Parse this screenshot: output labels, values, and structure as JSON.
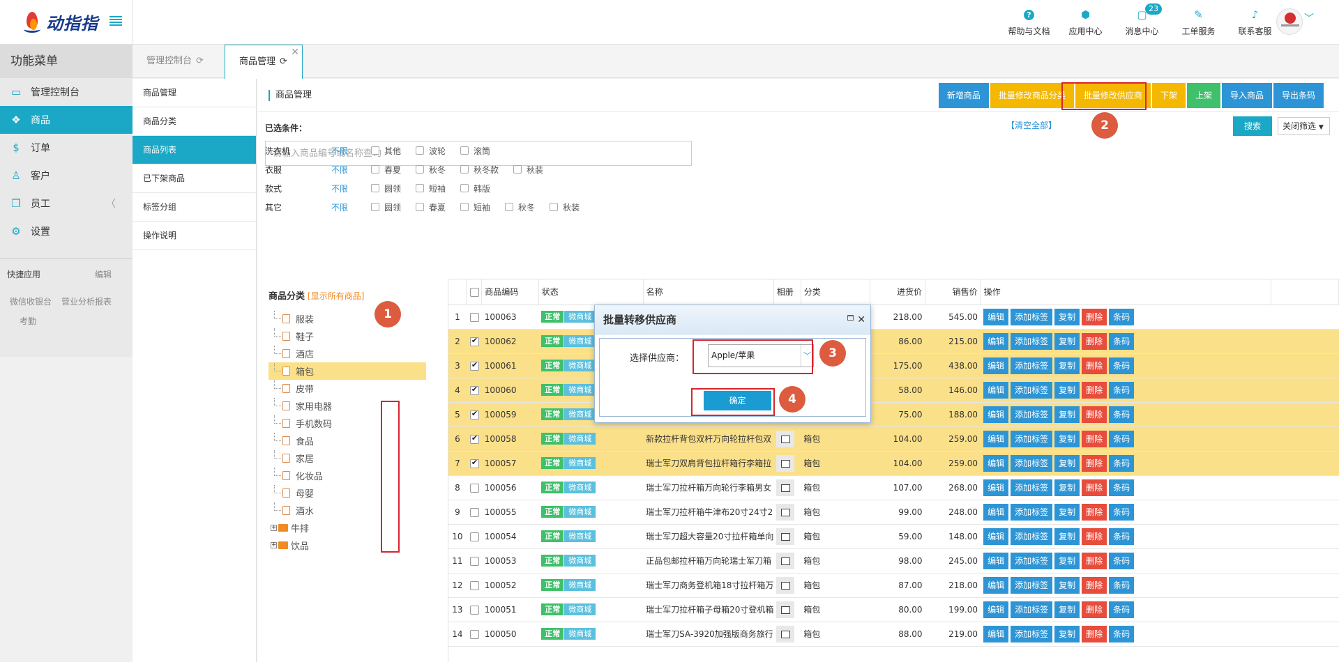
{
  "brand": {
    "logo_text": "动指指"
  },
  "sidebar": {
    "title": "功能菜单",
    "items": [
      {
        "label": "管理控制台",
        "icon": "monitor-icon"
      },
      {
        "label": "商品",
        "icon": "gift-icon",
        "active": true
      },
      {
        "label": "订单",
        "icon": "dollar-icon"
      },
      {
        "label": "客户",
        "icon": "user-icon"
      },
      {
        "label": "员工",
        "icon": "copy-icon"
      },
      {
        "label": "设置",
        "icon": "gear-icon"
      }
    ],
    "quick_apps_label": "快捷应用",
    "quick_edit_label": "编辑",
    "quick_links": [
      "微信收银台",
      "营业分析报表",
      "考勤"
    ]
  },
  "topnav": {
    "items": [
      {
        "label": "帮助与文档",
        "icon": "help-icon"
      },
      {
        "label": "应用中心",
        "icon": "cube-icon"
      },
      {
        "label": "消息中心",
        "icon": "message-icon",
        "badge": "23"
      },
      {
        "label": "工单服务",
        "icon": "pencil-icon"
      },
      {
        "label": "联系客服",
        "icon": "bell-icon"
      }
    ]
  },
  "tabs": [
    {
      "label": "管理控制台"
    },
    {
      "label": "商品管理",
      "active": true
    }
  ],
  "submenu": [
    "商品管理",
    "商品分类",
    "商品列表",
    "已下架商品",
    "标签分组",
    "操作说明"
  ],
  "main": {
    "page_title": "商品管理",
    "actions": [
      "新增商品",
      "批量修改商品分类",
      "批量修改供应商",
      "下架",
      "上架",
      "导入商品",
      "导出条码"
    ],
    "selected_conditions_label": "已选条件：",
    "clear_all": "【清空全部】",
    "search_button": "搜索",
    "close_filter": "关闭筛选",
    "search_placeholder": "请输入商品编号或名称查询"
  },
  "filters": [
    {
      "label": "洗衣机",
      "all": "不限",
      "options": [
        "其他",
        "波轮",
        "滚筒"
      ]
    },
    {
      "label": "衣服",
      "all": "不限",
      "options": [
        "春夏",
        "秋冬",
        "秋冬款",
        "秋装"
      ]
    },
    {
      "label": "款式",
      "all": "不限",
      "options": [
        "圆领",
        "短袖",
        "韩版"
      ]
    },
    {
      "label": "其它",
      "all": "不限",
      "options": [
        "圆领",
        "春夏",
        "短袖",
        "秋冬",
        "秋装"
      ]
    }
  ],
  "categories": {
    "title": "商品分类",
    "show_all": "[显示所有商品]",
    "items": [
      "服装",
      "鞋子",
      "酒店",
      "箱包",
      "皮带",
      "家用电器",
      "手机数码",
      "食品",
      "家居",
      "化妆品",
      "母婴",
      "酒水"
    ],
    "folders": [
      "牛排",
      "饮品"
    ],
    "selected": "箱包"
  },
  "table": {
    "columns": [
      "商品编码",
      "状态",
      "名称",
      "相册",
      "分类",
      "进货价",
      "销售价",
      "操作"
    ],
    "status_ok": "正常",
    "status_wx": "微商城",
    "ops": [
      "编辑",
      "添加标签",
      "复制",
      "删除",
      "条码"
    ],
    "rows": [
      {
        "idx": "1",
        "code": "100063",
        "name": "",
        "cat": "",
        "buy": "218.00",
        "sell": "545.00",
        "checked": false,
        "hl": false
      },
      {
        "idx": "2",
        "code": "100062",
        "name": "",
        "cat": "",
        "buy": "86.00",
        "sell": "215.00",
        "checked": true,
        "hl": true
      },
      {
        "idx": "3",
        "code": "100061",
        "name": "",
        "cat": "",
        "buy": "175.00",
        "sell": "438.00",
        "checked": true,
        "hl": true
      },
      {
        "idx": "4",
        "code": "100060",
        "name": "",
        "cat": "",
        "buy": "58.00",
        "sell": "146.00",
        "checked": true,
        "hl": true
      },
      {
        "idx": "5",
        "code": "100059",
        "name": "",
        "cat": "",
        "buy": "75.00",
        "sell": "188.00",
        "checked": true,
        "hl": true
      },
      {
        "idx": "6",
        "code": "100058",
        "name": "新款拉杆背包双杆万向轮拉杆包双",
        "cat": "箱包",
        "buy": "104.00",
        "sell": "259.00",
        "checked": true,
        "hl": true
      },
      {
        "idx": "7",
        "code": "100057",
        "name": "瑞士军刀双肩背包拉杆箱行李箱拉",
        "cat": "箱包",
        "buy": "104.00",
        "sell": "259.00",
        "checked": true,
        "hl": true
      },
      {
        "idx": "8",
        "code": "100056",
        "name": "瑞士军刀拉杆箱万向轮行李箱男女",
        "cat": "箱包",
        "buy": "107.00",
        "sell": "268.00",
        "checked": false,
        "hl": false
      },
      {
        "idx": "9",
        "code": "100055",
        "name": "瑞士军刀拉杆箱牛津布20寸24寸2",
        "cat": "箱包",
        "buy": "99.00",
        "sell": "248.00",
        "checked": false,
        "hl": false
      },
      {
        "idx": "10",
        "code": "100054",
        "name": "瑞士军刀超大容量20寸拉杆箱单向",
        "cat": "箱包",
        "buy": "59.00",
        "sell": "148.00",
        "checked": false,
        "hl": false
      },
      {
        "idx": "11",
        "code": "100053",
        "name": "正品包邮拉杆箱万向轮瑞士军刀箱",
        "cat": "箱包",
        "buy": "98.00",
        "sell": "245.00",
        "checked": false,
        "hl": false
      },
      {
        "idx": "12",
        "code": "100052",
        "name": "瑞士军刀商务登机箱18寸拉杆箱万",
        "cat": "箱包",
        "buy": "87.00",
        "sell": "218.00",
        "checked": false,
        "hl": false
      },
      {
        "idx": "13",
        "code": "100051",
        "name": "瑞士军刀拉杆箱子母箱20寸登机箱",
        "cat": "箱包",
        "buy": "80.00",
        "sell": "199.00",
        "checked": false,
        "hl": false
      },
      {
        "idx": "14",
        "code": "100050",
        "name": "瑞士军刀SA-3920加强版商务旅行",
        "cat": "箱包",
        "buy": "88.00",
        "sell": "219.00",
        "checked": false,
        "hl": false
      }
    ]
  },
  "modal": {
    "title": "批量转移供应商",
    "label": "选择供应商：",
    "selected_value": "Apple/苹果",
    "ok_button": "确定"
  },
  "annotations": [
    "1",
    "2",
    "3",
    "4"
  ]
}
